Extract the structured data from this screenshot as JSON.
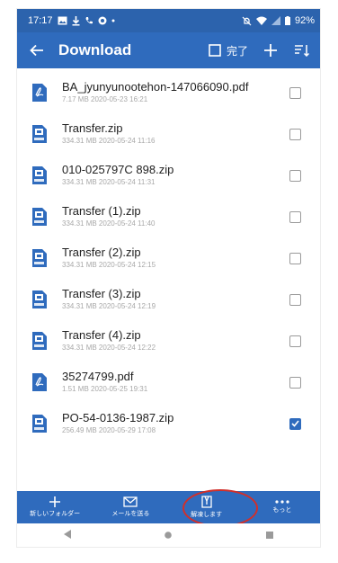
{
  "status_bar": {
    "time": "17:17",
    "battery": "92%"
  },
  "app_bar": {
    "title": "Download",
    "done_label": "完了"
  },
  "files": [
    {
      "name": "BA_jyunyunootehon-147066090.pdf",
      "meta": "7.17 MB 2020-05-23 16:21",
      "type": "pdf",
      "checked": false
    },
    {
      "name": "Transfer.zip",
      "meta": "334.31 MB 2020-05-24 11:16",
      "type": "zip",
      "checked": false
    },
    {
      "name": "010-025797C 898.zip",
      "meta": "334.31 MB 2020-05-24 11:31",
      "type": "zip",
      "checked": false
    },
    {
      "name": "Transfer (1).zip",
      "meta": "334.31 MB 2020-05-24 11:40",
      "type": "zip",
      "checked": false
    },
    {
      "name": "Transfer (2).zip",
      "meta": "334.31 MB 2020-05-24 12:15",
      "type": "zip",
      "checked": false
    },
    {
      "name": "Transfer (3).zip",
      "meta": "334.31 MB 2020-05-24 12:19",
      "type": "zip",
      "checked": false
    },
    {
      "name": "Transfer (4).zip",
      "meta": "334.31 MB 2020-05-24 12:22",
      "type": "zip",
      "checked": false
    },
    {
      "name": "35274799.pdf",
      "meta": "1.51 MB 2020-05-25 19:31",
      "type": "pdf",
      "checked": false
    },
    {
      "name": "PO-54-0136-1987.zip",
      "meta": "256.49 MB 2020-05-29 17:08",
      "type": "zip",
      "checked": true
    }
  ],
  "bottom_bar": {
    "new_folder": "新しいフォルダー",
    "send_mail": "メールを送る",
    "extract": "解凍します",
    "more": "もっと"
  },
  "colors": {
    "primary": "#2f6bbd",
    "status": "#2c63ad",
    "highlight": "#d0302b",
    "pdf": "#2f6bbd",
    "zip": "#2f6bbd"
  },
  "icons": {
    "pdf": "pdf-file-icon",
    "zip": "zip-file-icon"
  }
}
